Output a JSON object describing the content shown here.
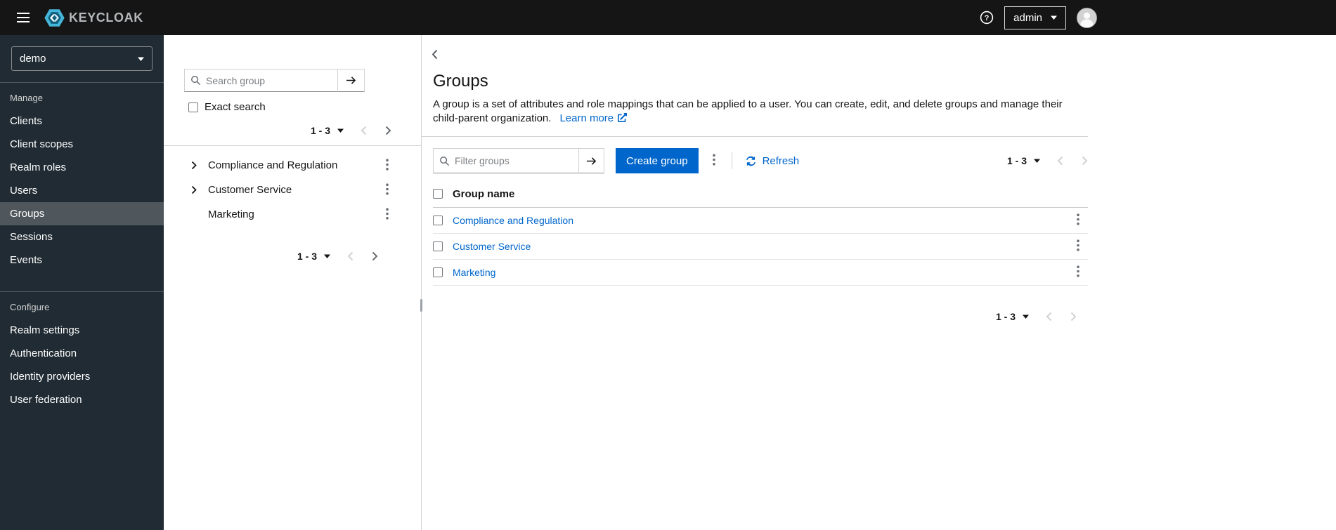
{
  "colors": {
    "accent": "#0066cc",
    "masthead_bg": "#151515",
    "sidebar_bg": "#202b33",
    "sidebar_selected_bg": "#4f565c",
    "link": "#0066cc"
  },
  "masthead": {
    "brand": "KEYCLOAK",
    "user": "admin"
  },
  "sidebar": {
    "realm": "demo",
    "selected_item": "Groups",
    "sections": [
      {
        "label": "Manage",
        "items": [
          "Clients",
          "Client scopes",
          "Realm roles",
          "Users",
          "Groups",
          "Sessions",
          "Events"
        ]
      },
      {
        "label": "Configure",
        "items": [
          "Realm settings",
          "Authentication",
          "Identity providers",
          "User federation"
        ]
      }
    ]
  },
  "tree_panel": {
    "search_placeholder": "Search group",
    "exact_search_label": "Exact search",
    "pagination_top": "1 - 3",
    "pagination_bottom": "1 - 3",
    "items": [
      {
        "label": "Compliance and Regulation",
        "expandable": true
      },
      {
        "label": "Customer Service",
        "expandable": true
      },
      {
        "label": "Marketing",
        "expandable": false
      }
    ]
  },
  "main": {
    "title": "Groups",
    "description": "A group is a set of attributes and role mappings that can be applied to a user. You can create, edit, and delete groups and manage their child-parent organization.",
    "learn_more_label": "Learn more",
    "toolbar": {
      "filter_placeholder": "Filter groups",
      "create_button_label": "Create group",
      "refresh_label": "Refresh",
      "pagination": "1 - 3"
    },
    "table": {
      "column_header": "Group name",
      "rows": [
        "Compliance and Regulation",
        "Customer Service",
        "Marketing"
      ]
    },
    "pagination_bottom": "1 - 3"
  }
}
